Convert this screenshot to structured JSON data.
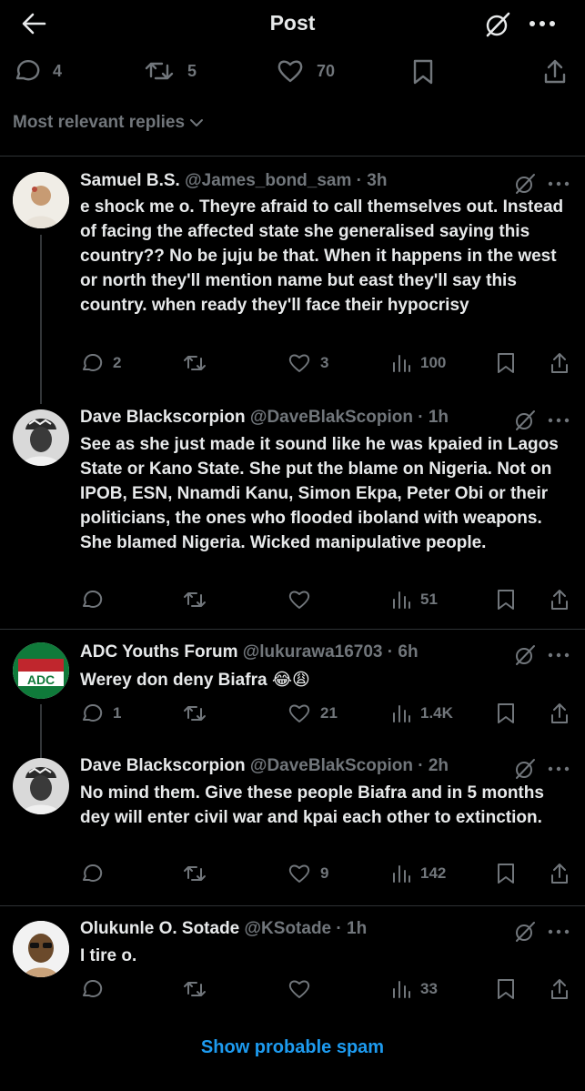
{
  "header": {
    "title": "Post",
    "back_icon": "arrow-left-icon",
    "grok_icon": "grok-icon",
    "more_icon": "more-horizontal-icon"
  },
  "engagement": {
    "replies": "4",
    "reposts": "5",
    "likes": "70"
  },
  "sort_label": "Most relevant replies",
  "replies": [
    {
      "name": "Samuel B.S.",
      "handle": "@James_bond_sam",
      "time": "· 3h",
      "text": "e shock me o. Theyre afraid to call themselves out. Instead of facing the affected state she generalised saying this country?? No be juju be that. When it happens in the west or north they'll mention name but east they'll say this country. when ready they'll face their hypocrisy",
      "replies": "2",
      "reposts": "",
      "likes": "3",
      "views": "100"
    },
    {
      "name": "Dave Blackscorpion",
      "handle": "@DaveBlakScopion",
      "time": "· 1h",
      "text": "See as she just made it sound like he was kpaied in Lagos State or Kano State. She put the blame on Nigeria. Not on IPOB, ESN, Nnamdi Kanu, Simon Ekpa, Peter Obi or their politicians, the ones who flooded iboland with weapons. She blamed Nigeria. Wicked manipulative people.",
      "replies": "",
      "reposts": "",
      "likes": "",
      "views": "51"
    },
    {
      "name": "ADC Youths Forum",
      "handle": "@lukurawa16703",
      "time": "· 6h",
      "text": "Werey don deny Biafra 😂😩",
      "replies": "1",
      "reposts": "",
      "likes": "21",
      "views": "1.4K",
      "avatar_label": "ADC"
    },
    {
      "name": "Dave Blackscorpion",
      "handle": "@DaveBlakScopion",
      "time": "· 2h",
      "text": "No mind them. Give these people Biafra and in 5 months dey will enter civil war and kpai each other to extinction.",
      "replies": "",
      "reposts": "",
      "likes": "9",
      "views": "142"
    },
    {
      "name": "Olukunle O. Sotade",
      "handle": "@KSotade",
      "time": "· 1h",
      "text": "I tire o.",
      "replies": "",
      "reposts": "",
      "likes": "",
      "views": "33"
    }
  ],
  "show_spam": "Show probable spam",
  "colors": {
    "background": "#000000",
    "text": "#e7e9ea",
    "muted": "#71767b",
    "accent": "#1d9bf0",
    "divider": "#2f3336"
  }
}
